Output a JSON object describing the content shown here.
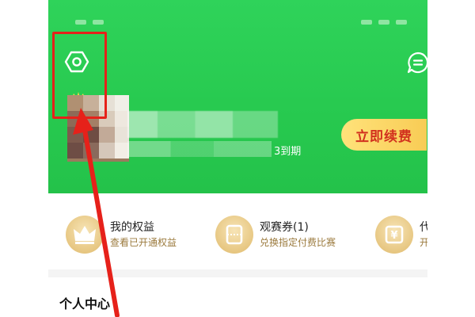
{
  "status_bar": {
    "left": "...",
    "right": "..."
  },
  "header": {
    "settings_icon": "gear-icon",
    "message_icon": "message-icon",
    "expire_suffix": "3到期",
    "renew_label": "立即续费"
  },
  "benefits": [
    {
      "title": "我的权益",
      "subtitle": "查看已开通权益",
      "icon": "crown-icon"
    },
    {
      "title": "观赛券(1)",
      "subtitle": "兑换指定付费比赛",
      "icon": "ticket-icon"
    },
    {
      "title": "代",
      "subtitle": "开",
      "icon": "yen-coupon-icon"
    }
  ],
  "section": {
    "title": "个人中心"
  },
  "colors": {
    "brand_green": "#27c94f",
    "renew_text": "#d2311e",
    "renew_bg": "#f8cc55",
    "highlight": "#e6211a",
    "gold": "#e7c782"
  }
}
